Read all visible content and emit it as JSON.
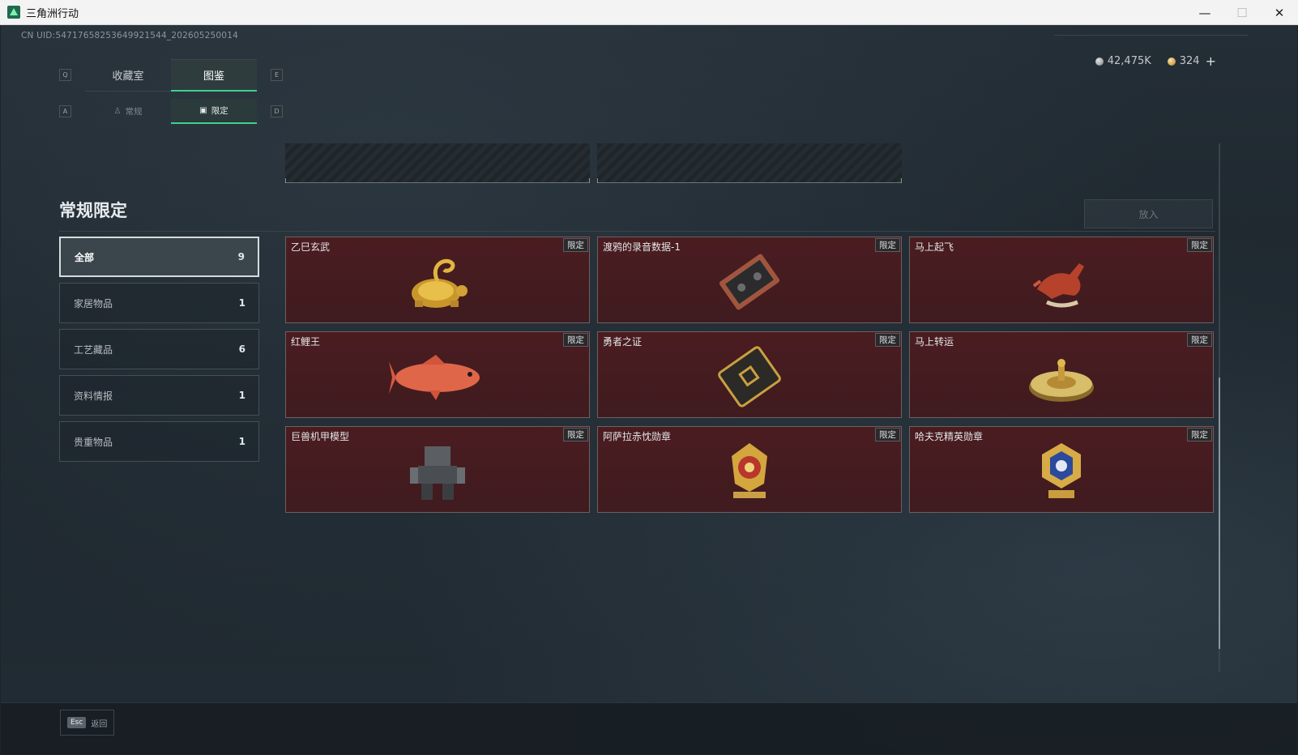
{
  "window": {
    "title": "三角洲行动",
    "min": "—",
    "max": "☐",
    "close": "✕"
  },
  "uid": "CN UID:5471765825364992154​4_202605250014",
  "currency": {
    "silver": "42,475K",
    "gold": "324",
    "plus": "+"
  },
  "keys": {
    "q": "Q",
    "e": "E",
    "a": "A",
    "d": "D",
    "esc": "Esc"
  },
  "tabs": {
    "main": [
      "收藏室",
      "图鉴"
    ],
    "sub": [
      "常规",
      "限定"
    ]
  },
  "section": {
    "title": "常规限定",
    "place_button": "放入"
  },
  "categories": [
    {
      "label": "全部",
      "count": "9"
    },
    {
      "label": "家居物品",
      "count": "1"
    },
    {
      "label": "工艺藏品",
      "count": "6"
    },
    {
      "label": "资料情报",
      "count": "1"
    },
    {
      "label": "贵重物品",
      "count": "1"
    }
  ],
  "items": [
    {
      "name": "乙巳玄武",
      "badge": "限定",
      "icon": "golden-turtle-snake-icon"
    },
    {
      "name": "渡鸦的录音数据-1",
      "badge": "限定",
      "icon": "cassette-tape-icon"
    },
    {
      "name": "马上起飞",
      "badge": "限定",
      "icon": "red-horse-statue-icon"
    },
    {
      "name": "红鲤王",
      "badge": "限定",
      "icon": "red-carp-icon"
    },
    {
      "name": "勇者之证",
      "badge": "限定",
      "icon": "brave-card-icon"
    },
    {
      "name": "马上转运",
      "badge": "限定",
      "icon": "golden-wheel-icon"
    },
    {
      "name": "巨兽机甲模型",
      "badge": "限定",
      "icon": "mech-model-icon"
    },
    {
      "name": "阿萨拉赤忱勋章",
      "badge": "限定",
      "icon": "red-medal-icon"
    },
    {
      "name": "哈夫克精英勋章",
      "badge": "限定",
      "icon": "blue-medal-icon"
    }
  ],
  "bottom": {
    "back_label": "返回"
  },
  "colors": {
    "accent": "#3fd08d",
    "card_bg": "#4a1c20",
    "background": "#1c252c"
  }
}
